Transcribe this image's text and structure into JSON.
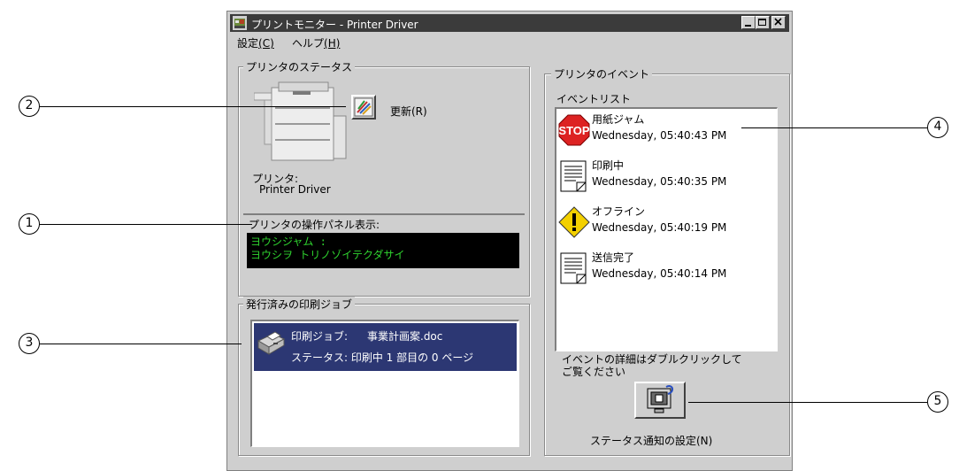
{
  "window": {
    "title": "プリントモニター - Printer Driver"
  },
  "menu": [
    {
      "label": "設定",
      "accel": "(C)"
    },
    {
      "label": "ヘルプ",
      "accel": "(H)"
    }
  ],
  "status_group": {
    "title": "プリンタのステータス",
    "refresh_label": "更新(R)",
    "printer_caption": "プリンタ:",
    "printer_name": "Printer Driver"
  },
  "panel": {
    "title": "プリンタの操作パネル表示:",
    "lines": [
      "ヨウシジャム :",
      "ヨウシヲ トリノゾイテクダサイ"
    ]
  },
  "jobs_group": {
    "title": "発行済みの印刷ジョブ",
    "job_label": "印刷ジョブ:",
    "job_name": "事業計画案.doc",
    "status_text": "ステータス: 印刷中 1 部目の 0 ページ"
  },
  "events_group": {
    "title": "プリンタのイベント",
    "list_label": "イベントリスト",
    "events": [
      {
        "icon": "stop-icon",
        "name": "用紙ジャム",
        "time": "Wednesday, 05:40:43 PM"
      },
      {
        "icon": "document-icon",
        "name": "印刷中",
        "time": "Wednesday, 05:40:35 PM"
      },
      {
        "icon": "warning-icon",
        "name": "オフライン",
        "time": "Wednesday, 05:40:19 PM"
      },
      {
        "icon": "document-icon",
        "name": "送信完了",
        "time": "Wednesday, 05:40:14 PM"
      }
    ],
    "hint_line1": "イベントの詳細はダブルクリックして",
    "hint_line2": "ご覧ください",
    "notify_label": "ステータス通知の設定(N)",
    "stop_text": "STOP"
  },
  "callouts": [
    "1",
    "2",
    "3",
    "4",
    "5"
  ],
  "colors": {
    "titlebar": "#3b3b3b",
    "window_bg": "#cfcfcf",
    "selection": "#2c3773",
    "lcd_text": "#2fd42f"
  }
}
